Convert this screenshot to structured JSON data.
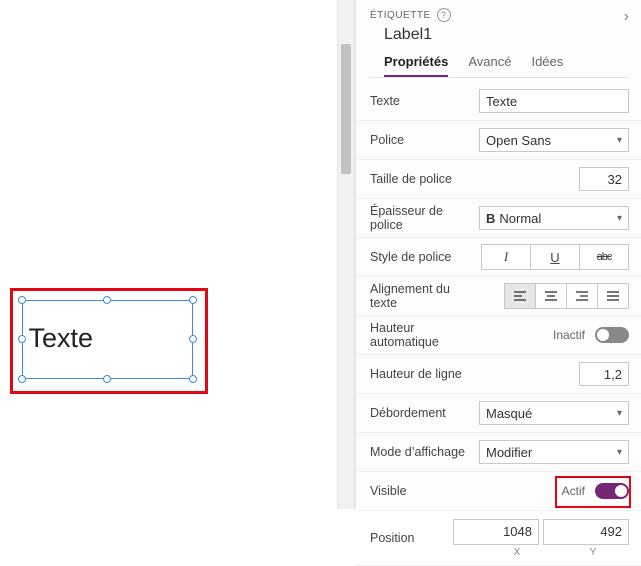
{
  "canvas": {
    "label_text": "Texte"
  },
  "panel": {
    "type_label": "ÉTIQUETTE",
    "control_name": "Label1",
    "tabs": {
      "props": "Propriétés",
      "advanced": "Avancé",
      "ideas": "Idées"
    },
    "rows": {
      "text_label": "Texte",
      "text_value": "Texte",
      "font_label": "Police",
      "font_value": "Open Sans",
      "fontsize_label": "Taille de police",
      "fontsize_value": "32",
      "fontweight_label": "Épaisseur de police",
      "fontweight_value": "Normal",
      "fontstyle_label": "Style de police",
      "textalign_label": "Alignement du texte",
      "autoheight_label": "Hauteur automatique",
      "autoheight_state": "Inactif",
      "lineheight_label": "Hauteur de ligne",
      "lineheight_value": "1,2",
      "overflow_label": "Débordement",
      "overflow_value": "Masqué",
      "displaymode_label": "Mode d’affichage",
      "displaymode_value": "Modifier",
      "visible_label": "Visible",
      "visible_state": "Actif",
      "position_label": "Position",
      "position_x": "1048",
      "position_y": "492",
      "axis_x": "X",
      "axis_y": "Y"
    }
  }
}
